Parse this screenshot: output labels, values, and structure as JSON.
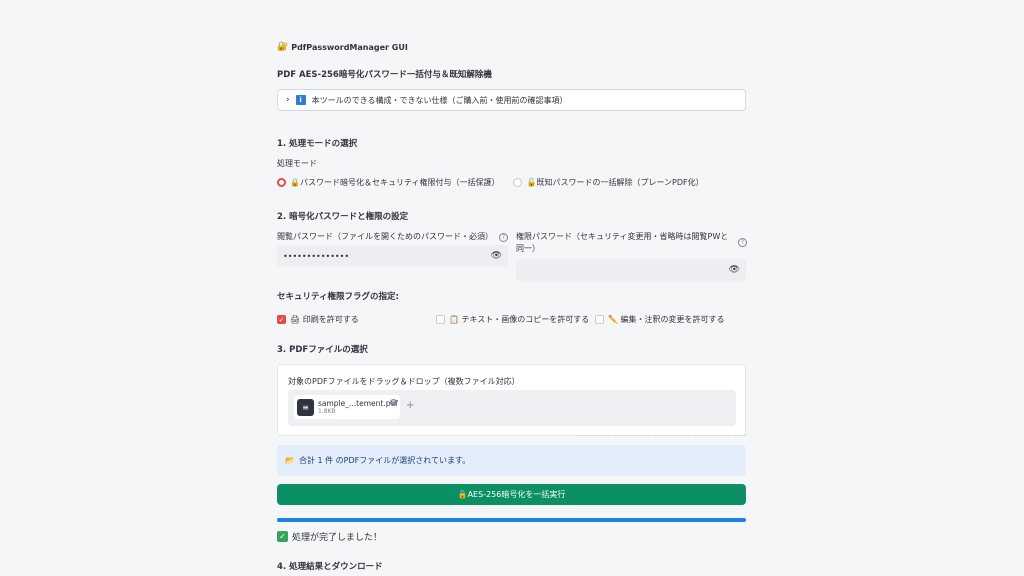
{
  "app": {
    "title": "PdfPasswordManager GUI",
    "logo_icon": "🔐",
    "subtitle": "PDF AES-256暗号化パスワード一括付与＆既知解除機"
  },
  "expander": {
    "label": "本ツールのできる構成・できない仕様（ご購入前・使用前の確認事項）",
    "icon": "info-icon",
    "chevron": "›"
  },
  "mode": {
    "heading": "1. 処理モードの選択",
    "label": "処理モード",
    "options": [
      {
        "label": "🔒パスワード暗号化＆セキュリティ権限付与（一括保護）",
        "selected": true
      },
      {
        "label": "🔓既知パスワードの一括解除（プレーンPDF化）",
        "selected": false
      }
    ]
  },
  "passwords": {
    "heading": "2. 暗号化パスワードと権限の設定",
    "view_label": "閲覧パスワード（ファイルを開くためのパスワード・必須）",
    "view_value": "••••••••••••••",
    "owner_label": "権限パスワード（セキュリティ変更用・省略時は閲覧PWと同一）",
    "owner_value": ""
  },
  "flags": {
    "heading": "セキュリティ権限フラグの指定:",
    "items": [
      {
        "label": "🖨 印刷を許可する",
        "checked": true
      },
      {
        "label": "📋 テキスト・画像のコピーを許可する",
        "checked": false
      },
      {
        "label": "✏️ 編集・注釈の変更を許可する",
        "checked": false
      }
    ]
  },
  "files": {
    "heading": "3. PDFファイルの選択",
    "uploader_label": "対象のPDFファイルをドラッグ＆ドロップ（複数ファイル対応）",
    "file_name": "sample_...tement.pdf",
    "file_size": "1.8KB",
    "add": "+"
  },
  "summary": {
    "icon": "📂",
    "text": "合計 1 件 のPDFファイルが選択されています。"
  },
  "action": {
    "button_label": "🔒AES-256暗号化を一括実行"
  },
  "progress": {
    "value": 1.0
  },
  "status": {
    "icon": "✓",
    "text": "処理が完了しました！"
  },
  "results": {
    "heading": "4. 処理結果とダウンロード"
  },
  "colors": {
    "accent": "#e5484d",
    "button": "#0b8f63",
    "progress": "#1c83e1",
    "info_bg": "#e3edfb"
  }
}
